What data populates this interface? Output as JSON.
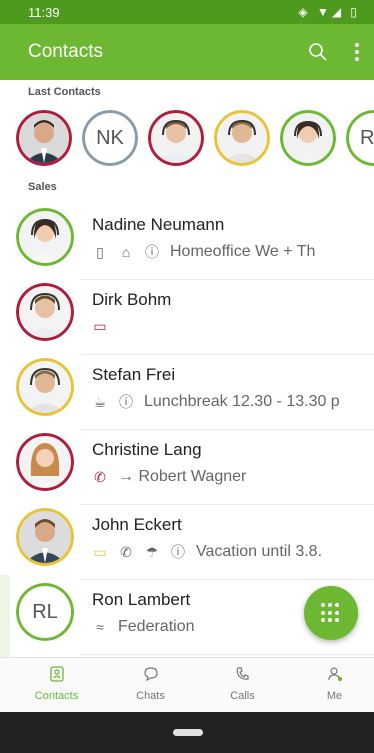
{
  "status": {
    "time": "11:39",
    "icons_text": "◈ ▼◢ ▯"
  },
  "appbar": {
    "title": "Contacts"
  },
  "sections": {
    "last_contacts": "Last Contacts",
    "sales": "Sales"
  },
  "recent_contacts": [
    {
      "initials": "",
      "ring": "#b01c3c"
    },
    {
      "initials": "NK",
      "ring": "#8a9aa8"
    },
    {
      "initials": "",
      "ring": "#b01c3c"
    },
    {
      "initials": "",
      "ring": "#e7c437"
    },
    {
      "initials": "",
      "ring": "#6db832"
    },
    {
      "initials": "R",
      "ring": "#6db832"
    }
  ],
  "contacts": [
    {
      "name": "Nadine Neumann",
      "status_text": "Homeoffice We + Th",
      "ring": "#6db832",
      "icons": [
        "phone-icon",
        "home-icon",
        "info-icon"
      ]
    },
    {
      "name": "Dirk Bohm",
      "status_text": "",
      "ring": "#b01c3c",
      "icons": [
        "calendar-icon"
      ]
    },
    {
      "name": "Stefan Frei",
      "status_text": "Lunchbreak 12.30 - 13.30 p",
      "ring": "#e7c437",
      "icons": [
        "coffee-icon",
        "info-icon"
      ]
    },
    {
      "name": "Christine Lang",
      "status_text": "→ Robert Wagner",
      "ring": "#b01c3c",
      "icons": [
        "call-forward-icon"
      ]
    },
    {
      "name": "John Eckert",
      "status_text": "Vacation until 3.8.",
      "ring": "#e7c437",
      "icons": [
        "calendar-icon",
        "phone-status-icon",
        "umbrella-icon",
        "info-icon"
      ]
    },
    {
      "name": "Ron Lambert",
      "initials": "RL",
      "status_text": "Federation",
      "ring": "#6db832",
      "icons": [
        "federation-icon"
      ]
    }
  ],
  "nav": {
    "contacts": "Contacts",
    "chats": "Chats",
    "calls": "Calls",
    "me": "Me"
  },
  "colors": {
    "primary": "#6db832",
    "primary_dark": "#4e9a1e",
    "busy": "#b01c3c",
    "away": "#e7c437"
  }
}
